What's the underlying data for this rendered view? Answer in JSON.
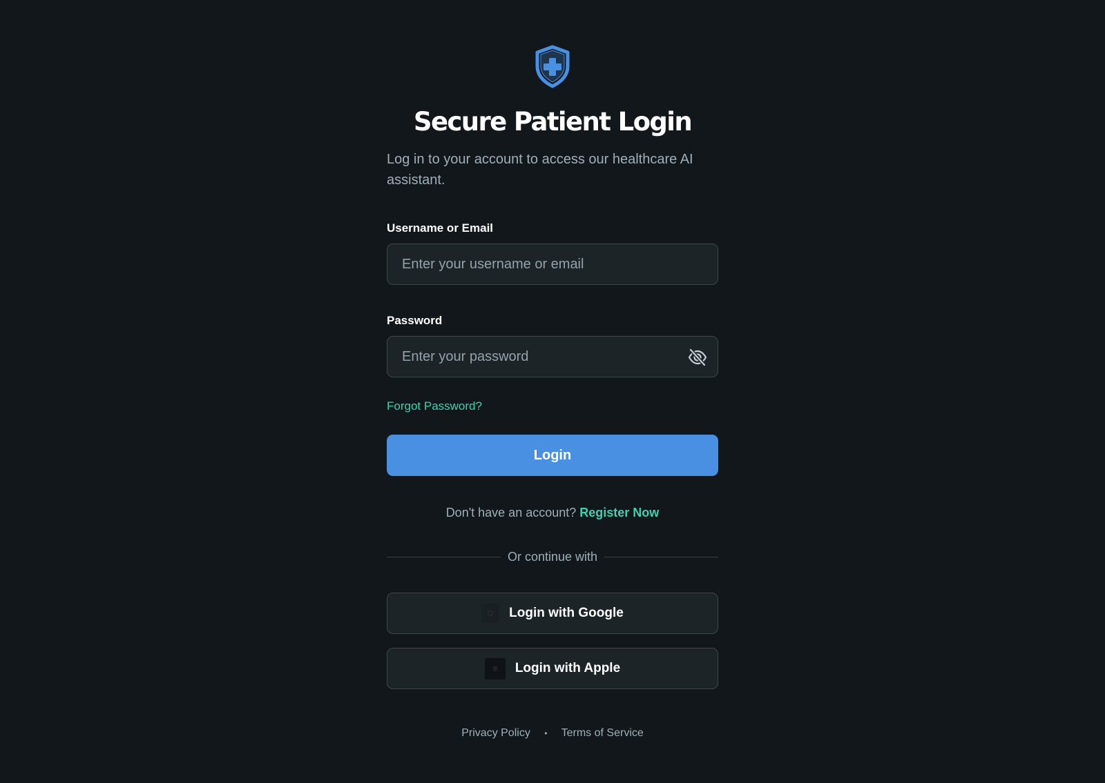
{
  "header": {
    "logo_icon": "shield-medical-cross-icon",
    "title": "Secure Patient Login",
    "subtitle": "Log in to your account to access our healthcare AI assistant."
  },
  "form": {
    "username_label": "Username or Email",
    "username_placeholder": "Enter your username or email",
    "username_value": "",
    "password_label": "Password",
    "password_placeholder": "Enter your password",
    "password_value": "",
    "password_toggle_icon": "eye-off-icon",
    "forgot_link": "Forgot Password?",
    "login_button": "Login"
  },
  "register": {
    "prompt": "Don't have an account?",
    "link": "Register Now"
  },
  "divider": {
    "text": "Or continue with"
  },
  "social": {
    "google_label": "Login with Google",
    "google_icon": "google-icon",
    "apple_label": "Login with Apple",
    "apple_icon": "apple-icon"
  },
  "footer": {
    "privacy": "Privacy Policy",
    "separator": "•",
    "terms": "Terms of Service"
  },
  "colors": {
    "background": "#11171b",
    "accent": "#4a90e2",
    "link": "#3ed2b0",
    "field_bg": "#1c2428"
  }
}
